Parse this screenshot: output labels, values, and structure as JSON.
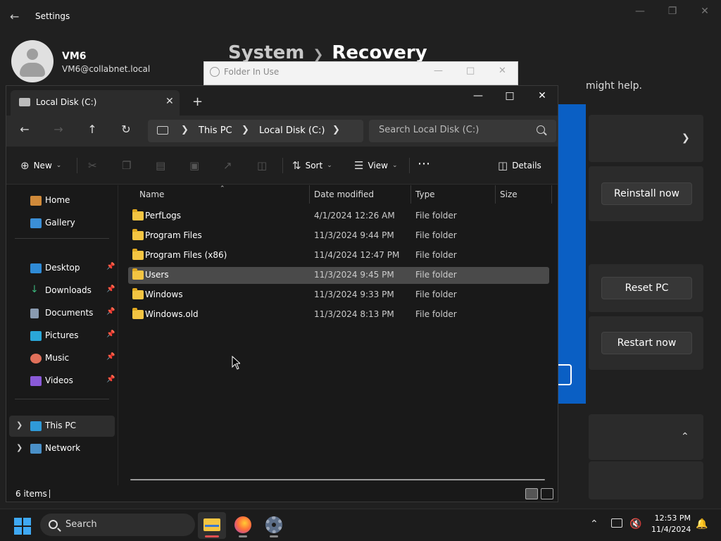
{
  "settings": {
    "title": "Settings",
    "user_name": "VM6",
    "user_email": "VM6@collabnet.local",
    "breadcrumb_parent": "System",
    "breadcrumb_current": "Recovery",
    "help_text_fragment": "might help.",
    "reinstall_label": "Reinstall now",
    "reset_label": "Reset PC",
    "restart_label": "Restart now"
  },
  "dialog": {
    "title": "Folder In Use"
  },
  "explorer": {
    "tab_label": "Local Disk (C:)",
    "address": [
      "This PC",
      "Local Disk (C:)"
    ],
    "search_placeholder": "Search Local Disk (C:)",
    "commands": {
      "new": "New",
      "sort": "Sort",
      "view": "View",
      "details": "Details"
    },
    "sidebar": {
      "quick": [
        {
          "label": "Home",
          "icon": "home-icon"
        },
        {
          "label": "Gallery",
          "icon": "gallery-icon"
        }
      ],
      "pinned": [
        {
          "label": "Desktop",
          "icon": "desktop-icon"
        },
        {
          "label": "Downloads",
          "icon": "downloads-icon"
        },
        {
          "label": "Documents",
          "icon": "documents-icon"
        },
        {
          "label": "Pictures",
          "icon": "pictures-icon"
        },
        {
          "label": "Music",
          "icon": "music-icon"
        },
        {
          "label": "Videos",
          "icon": "videos-icon"
        }
      ],
      "tree": [
        {
          "label": "This PC",
          "icon": "this-pc-icon"
        },
        {
          "label": "Network",
          "icon": "network-icon"
        }
      ]
    },
    "columns": [
      "Name",
      "Date modified",
      "Type",
      "Size"
    ],
    "rows": [
      {
        "name": "PerfLogs",
        "date": "4/1/2024 12:26 AM",
        "type": "File folder",
        "size": ""
      },
      {
        "name": "Program Files",
        "date": "11/3/2024 9:44 PM",
        "type": "File folder",
        "size": ""
      },
      {
        "name": "Program Files (x86)",
        "date": "11/4/2024 12:47 PM",
        "type": "File folder",
        "size": ""
      },
      {
        "name": "Users",
        "date": "11/3/2024 9:45 PM",
        "type": "File folder",
        "size": ""
      },
      {
        "name": "Windows",
        "date": "11/3/2024 9:33 PM",
        "type": "File folder",
        "size": ""
      },
      {
        "name": "Windows.old",
        "date": "11/3/2024 8:13 PM",
        "type": "File folder",
        "size": ""
      }
    ],
    "status": "6 items"
  },
  "taskbar": {
    "search_label": "Search",
    "time": "12:53 PM",
    "date": "11/4/2024"
  },
  "colors": {
    "accent": "#3fa9f5",
    "folder": "#f4c542",
    "dialog_blue": "#0a5fc4"
  }
}
